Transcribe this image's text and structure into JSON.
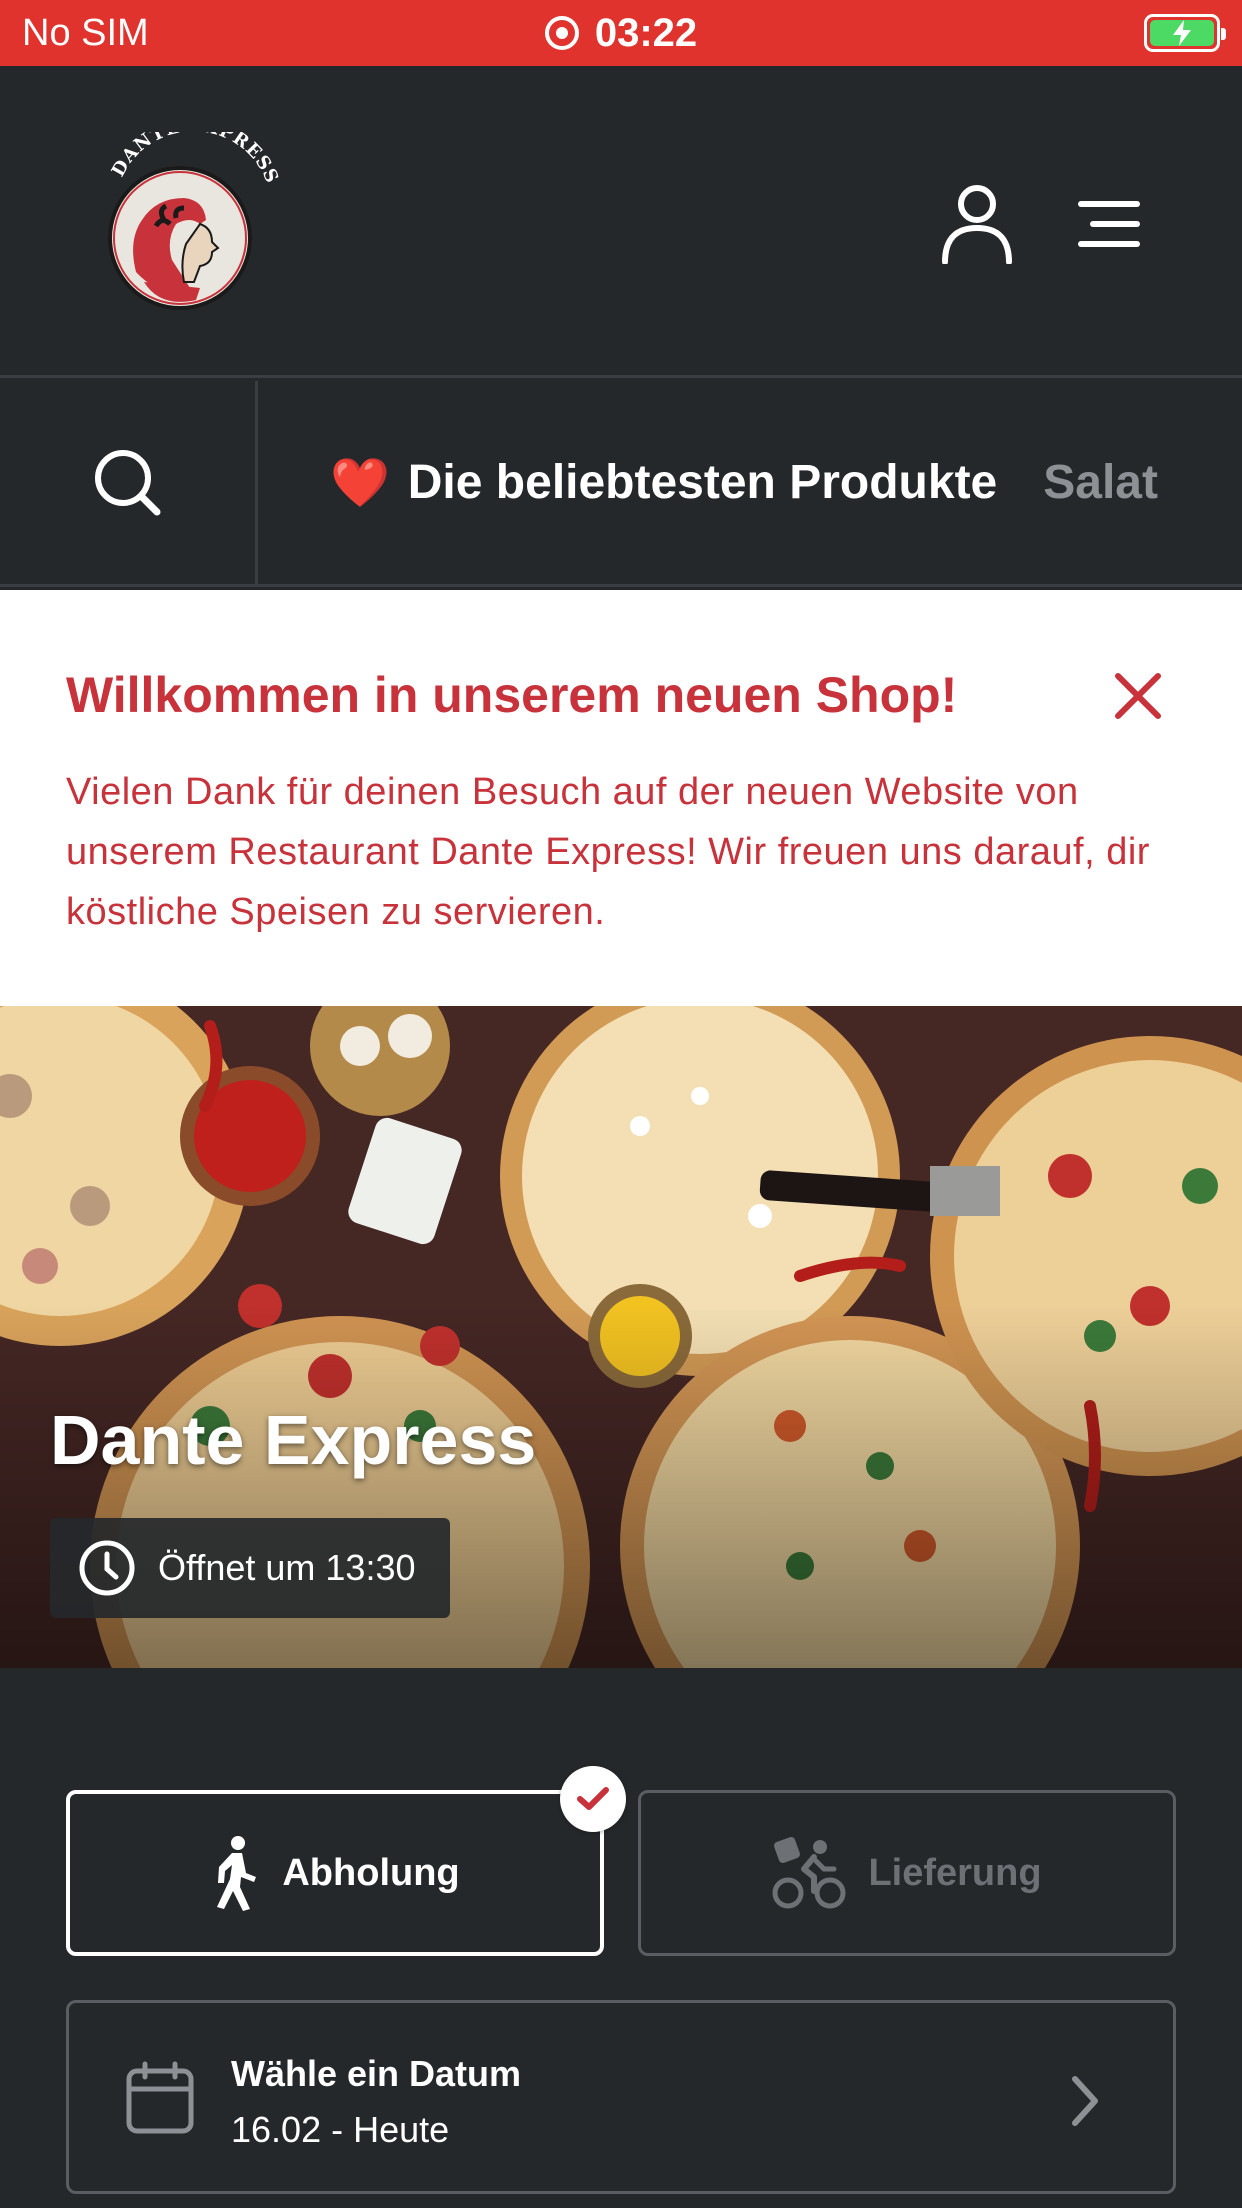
{
  "status_bar": {
    "carrier": "No SIM",
    "time": "03:22",
    "battery_color": "#4cd964"
  },
  "header": {
    "logo_text": "DANTE EXPRESS",
    "icons": [
      "user-icon",
      "menu-icon"
    ]
  },
  "category_nav": {
    "search_icon": "search-icon",
    "items": [
      {
        "emoji": "❤️",
        "label": "Die beliebtesten Produkte",
        "active": true
      },
      {
        "label": "Salat",
        "active": false
      }
    ]
  },
  "welcome_banner": {
    "title": "Willkommen in unserem neuen Shop!",
    "text": "Vielen Dank für deinen Besuch auf der neuen Website von unserem Restaurant Dante Express! Wir freuen uns darauf, dir köstliche Speisen zu servieren.",
    "accent_color": "#c8323a"
  },
  "hero": {
    "restaurant_name": "Dante Express",
    "hours_text": "Öffnet um 13:30"
  },
  "order_mode": {
    "options": [
      {
        "label": "Abholung",
        "icon": "walking-icon",
        "selected": true
      },
      {
        "label": "Lieferung",
        "icon": "bicycle-icon",
        "selected": false
      }
    ]
  },
  "date_picker": {
    "title": "Wähle ein Datum",
    "value": "16.02 - Heute"
  },
  "colors": {
    "brand_red": "#e0332d",
    "background": "#25282b"
  }
}
